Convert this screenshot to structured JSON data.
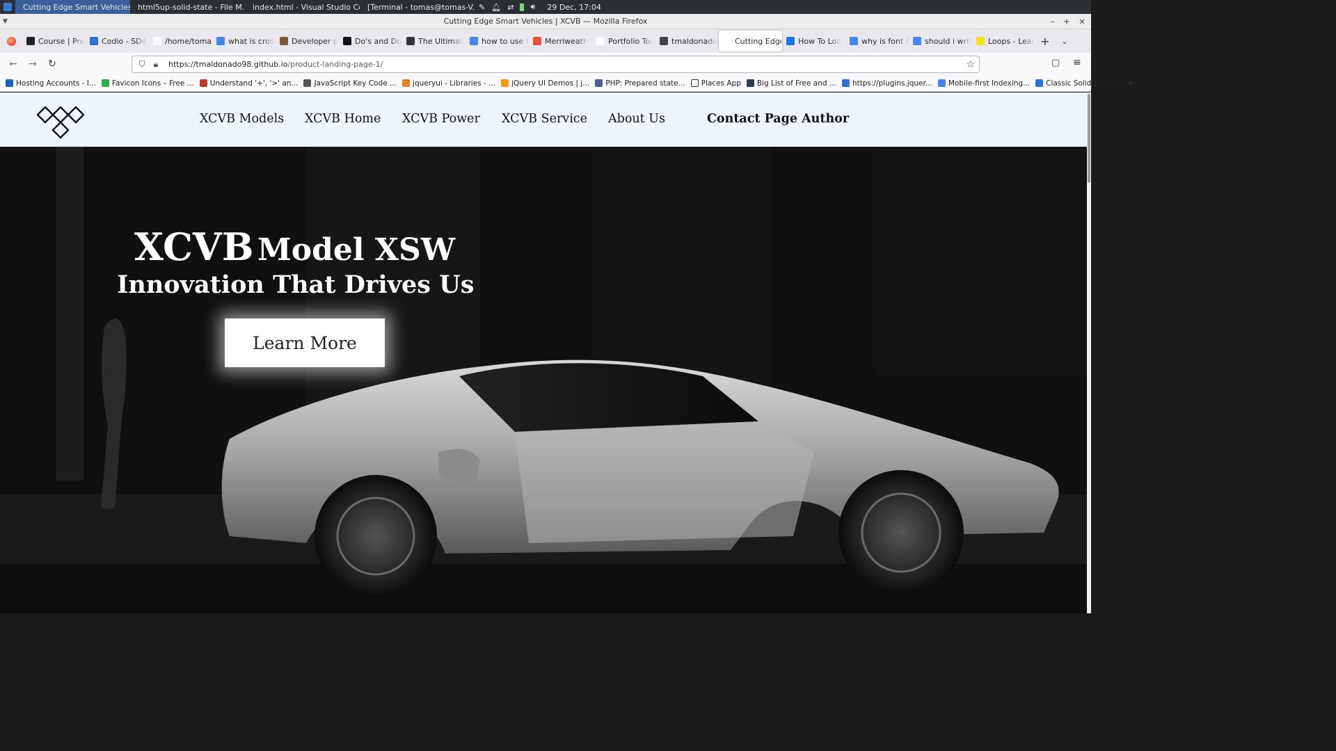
{
  "taskbar": {
    "apps": [
      {
        "label": "Cutting Edge Smart Vehicles...",
        "color": "#e66000",
        "active": true
      },
      {
        "label": "html5up-solid-state - File M...",
        "color": "#e0b84a"
      },
      {
        "label": "index.html - Visual Studio Co...",
        "color": "#2f80d1"
      },
      {
        "label": "[Terminal - tomas@tomas-V...",
        "color": "#555555"
      }
    ],
    "clock": "29 Dec, 17:04"
  },
  "window": {
    "title": "Cutting Edge Smart Vehicles | XCVB — Mozilla Firefox"
  },
  "tabs": [
    {
      "label": "Course | Pro",
      "color": "#222222"
    },
    {
      "label": "Codio - SD4",
      "color": "#2a6fdb"
    },
    {
      "label": "/home/tomas/re",
      "color": "#f9f9fb"
    },
    {
      "label": "what is cros",
      "color": "#4285f4"
    },
    {
      "label": "Developer p",
      "color": "#7a5a3a"
    },
    {
      "label": "Do's and Do",
      "color": "#111111"
    },
    {
      "label": "The Ultimat",
      "color": "#333333"
    },
    {
      "label": "how to use t",
      "color": "#4285f4"
    },
    {
      "label": "Merriweath",
      "color": "#e94e3c"
    },
    {
      "label": "Portfolio Tor",
      "color": "#f9f9fb"
    },
    {
      "label": "tmaldonado",
      "color": "#444444"
    },
    {
      "label": "Cutting Edge",
      "color": "#ffffff",
      "active": true
    },
    {
      "label": "How To Loa",
      "color": "#1a73e8"
    },
    {
      "label": "why is font f",
      "color": "#4285f4"
    },
    {
      "label": "should i writ",
      "color": "#4285f4"
    },
    {
      "label": "Loops - Lear",
      "color": "#f7df1e"
    }
  ],
  "url": {
    "host": "https://tmaldonado98.github.io",
    "path": "/product-landing-page-1/"
  },
  "bookmarks": [
    {
      "label": "Hosting Accounts - I...",
      "color": "#1565c0"
    },
    {
      "label": "Favicon Icons – Free ...",
      "color": "#2bb24c"
    },
    {
      "label": "Understand '+', '>' an...",
      "color": "#c0392b"
    },
    {
      "label": "JavaScript Key Code ...",
      "color": "#555555"
    },
    {
      "label": "jqueryui - Libraries - ...",
      "color": "#e67e22"
    },
    {
      "label": "jQuery UI Demos | j...",
      "color": "#f39c12"
    },
    {
      "label": "PHP: Prepared state...",
      "color": "#4f5b93"
    },
    {
      "label": "Places App",
      "color": "#f9f9fb"
    },
    {
      "label": "Big List of Free and ...",
      "color": "#2c3e50"
    },
    {
      "label": "https://plugins.jquer...",
      "color": "#2a6fdb"
    },
    {
      "label": "Mobile-first Indexing...",
      "color": "#4285f4"
    },
    {
      "label": "Classic Solid Style Ic...",
      "color": "#2a6fdb"
    }
  ],
  "site": {
    "nav": [
      "XCVB Models",
      "XCVB Home",
      "XCVB Power",
      "XCVB Service",
      "About Us"
    ],
    "contact": "Contact Page Author",
    "hero": {
      "brand": "XCVB",
      "model": "Model XSW",
      "subtitle": "Innovation That Drives Us",
      "cta": "Learn More"
    }
  }
}
